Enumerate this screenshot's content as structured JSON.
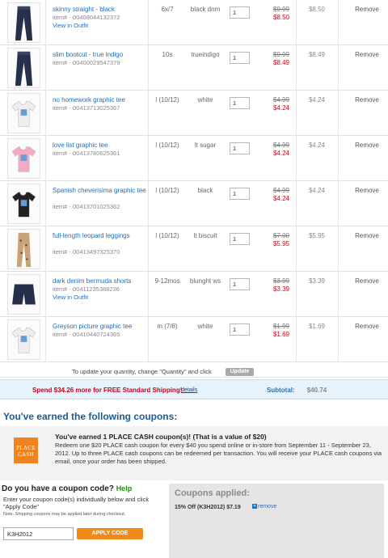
{
  "cart": {
    "items": [
      {
        "name": "skinny straight - black",
        "item_no": "",
        "outfit_link": "View in Outfit",
        "size": "6x/7",
        "color": "black dnm",
        "qty": "1",
        "orig_price": "$9.99",
        "sale_price": "$8.50",
        "total": "$8.50",
        "remove": "Remove",
        "thumb": "jeans-icon"
      },
      {
        "name": "slim bootcut - true indigo",
        "item_no": "item# - 00400029547379",
        "outfit_link": "",
        "size": "10s",
        "color": "trueindigo",
        "qty": "1",
        "orig_price": "$9.99",
        "sale_price": "$8.49",
        "total": "$8.49",
        "remove": "Remove",
        "thumb": "jeans-icon"
      },
      {
        "name": "no homework graphic tee",
        "item_no": "item# - 00413713025367",
        "outfit_link": "",
        "size": "l (10/12)",
        "color": "white",
        "qty": "1",
        "orig_price": "$4.99",
        "sale_price": "$4.24",
        "total": "$4.24",
        "remove": "Remove",
        "thumb": "tee-icon"
      },
      {
        "name": "love list graphic tee",
        "item_no": "item# - 00413780625361",
        "outfit_link": "",
        "size": "l (10/12)",
        "color": "lt sugar",
        "qty": "1",
        "orig_price": "$4.99",
        "sale_price": "$4.24",
        "total": "$4.24",
        "remove": "Remove",
        "thumb": "tee-icon"
      },
      {
        "name": "Spanish cheverisima graphic tee",
        "item_no": "item# - 00413701025362",
        "outfit_link": "",
        "size": "l (10/12)",
        "color": "black",
        "qty": "1",
        "orig_price": "$4.99",
        "sale_price": "$4.24",
        "total": "$4.24",
        "remove": "Remove",
        "thumb": "tee-icon"
      },
      {
        "name": "full-length leopard leggings",
        "item_no": "item# - 00413497325370",
        "outfit_link": "",
        "size": "l (10/12)",
        "color": "lt biscuit",
        "qty": "1",
        "orig_price": "$7.00",
        "sale_price": "$5.95",
        "total": "$5.95",
        "remove": "Remove",
        "thumb": "leggings-icon"
      },
      {
        "name": "dark denim bermuda shorts",
        "item_no": "item# - 00411235388236",
        "outfit_link": "View in Outfit",
        "size": "9-12mos",
        "color": "blunght ws",
        "qty": "1",
        "orig_price": "$3.99",
        "sale_price": "$3.39",
        "total": "$3.39",
        "remove": "Remove",
        "thumb": "shorts-icon"
      },
      {
        "name": "Greyson picture graphic tee",
        "item_no": "item# - 00410440724365",
        "outfit_link": "",
        "size": "m (7/8)",
        "color": "white",
        "qty": "1",
        "orig_price": "$1.99",
        "sale_price": "$1.69",
        "total": "$1.69",
        "remove": "Remove",
        "thumb": "tee-icon"
      }
    ],
    "first_item_no": "item# - 00408044132372",
    "update_text": "To update your quantity, change \"Quantity\" and click",
    "update_button": "Update"
  },
  "shipping": {
    "message": "Spend $34.26 more for FREE Standard Shipping!",
    "details_link": "details",
    "subtotal_label": "Subtotal:",
    "subtotal_value": "$40.74"
  },
  "coupons_earned": {
    "title": "You've earned the following coupons:",
    "logo_text": "PLACE CASH",
    "headline": "You've earned 1 PLACE CASH coupon(s)! (That is a value of $20)",
    "body": "Redeem one $20 PLACE cash coupon for every $40 you spend online or in-store from September 11 - September 23, 2012. Up to three PLACE cash coupons can be redeemed per transaction. You will receive your PLACE cash coupons via email, once your order has been shipped."
  },
  "coupon_code": {
    "question": "Do you have a coupon code?",
    "help": "Help",
    "instructions": "Enter your coupon code(s) individually below and click \"Apply Code\"",
    "note": "Note: Shipping coupons may be applied later during checkout.",
    "input_value": "K3H2012",
    "apply_button": "APPLY CODE"
  },
  "coupons_applied": {
    "title": "Coupons applied:",
    "line": "15% Off (K3H2012) $7.19",
    "remove": "remove"
  },
  "colors": {
    "link": "#1f6fbf",
    "sale": "#d0021b",
    "accent_orange": "#f28a1a",
    "heading_blue": "#1d5a91"
  }
}
